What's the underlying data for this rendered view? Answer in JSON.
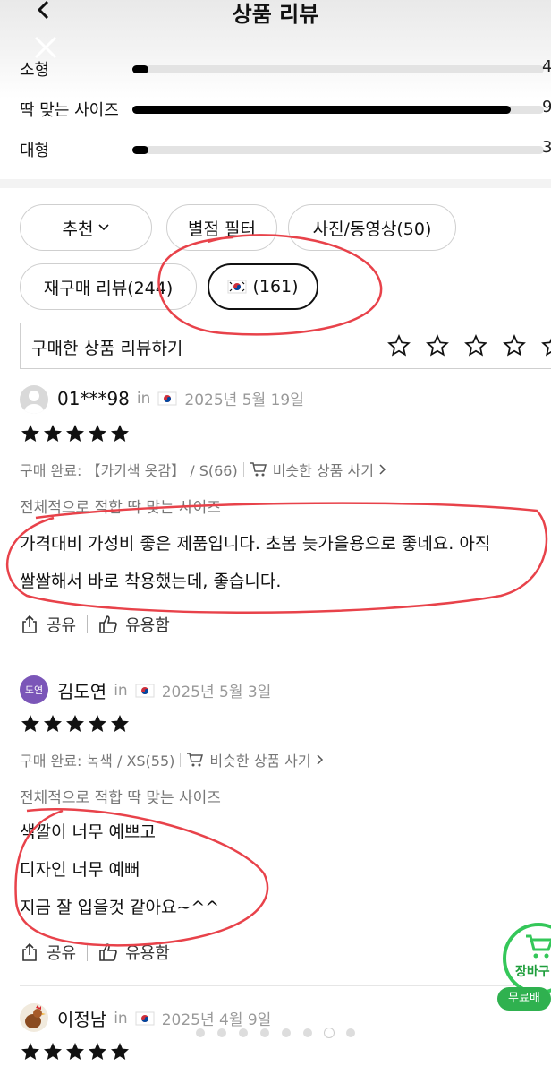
{
  "header": {
    "title": "상품 리뷰"
  },
  "size_dist": [
    {
      "label": "소형",
      "count": "4",
      "fraction": 0.04
    },
    {
      "label": "딱 맞는 사이즈",
      "count": "9",
      "fraction": 0.92
    },
    {
      "label": "대형",
      "count": "3",
      "fraction": 0.04
    }
  ],
  "filters": {
    "sort_label": "추천",
    "rating_filter": "별점 필터",
    "media_filter": "사진/동영상(50)",
    "repurchase_filter": "재구매 리뷰(244)",
    "country_filter": "(161)"
  },
  "write_review": {
    "label": "구매한 상품 리뷰하기",
    "star_count": 5
  },
  "reviews": [
    {
      "name": "01***98",
      "in": "in",
      "date": "2025년 5월 19일",
      "rating": 5,
      "purchase": "구매 완료: 【카키색 옷감】 / S(66)",
      "similar": "비슷한 상품 사기",
      "fit": "전체적으로 적합 딱 맞는 사이즈",
      "body": [
        "가격대비 가성비 좋은 제품입니다. 초봄 늦가을용으로 좋네요. 아직",
        "쌀쌀해서 바로 착용했는데, 좋습니다."
      ],
      "share": "공유",
      "helpful": "유용함"
    },
    {
      "name": "김도연",
      "avatar_text": "도연",
      "in": "in",
      "date": "2025년 5월 3일",
      "rating": 5,
      "purchase": "구매 완료: 녹색 / XS(55)",
      "similar": "비슷한 상품 사기",
      "fit": "전체적으로 적합 딱 맞는 사이즈",
      "body": [
        "색깔이 너무 예쁘고",
        "디자인 너무 예뻐",
        "지금 잘 입을것 같아요~^^"
      ],
      "share": "공유",
      "helpful": "유용함"
    },
    {
      "name": "이정남",
      "in": "in",
      "date": "2025년 4월 9일",
      "rating": 5
    }
  ],
  "cart_fab": {
    "label": "장바구",
    "free": "무료배"
  },
  "pager": {
    "count": 8,
    "active": 6
  },
  "colors": {
    "accent_green": "#34c759",
    "annotation_red": "#e8424a",
    "avatar_purple": "#7b56b8"
  }
}
